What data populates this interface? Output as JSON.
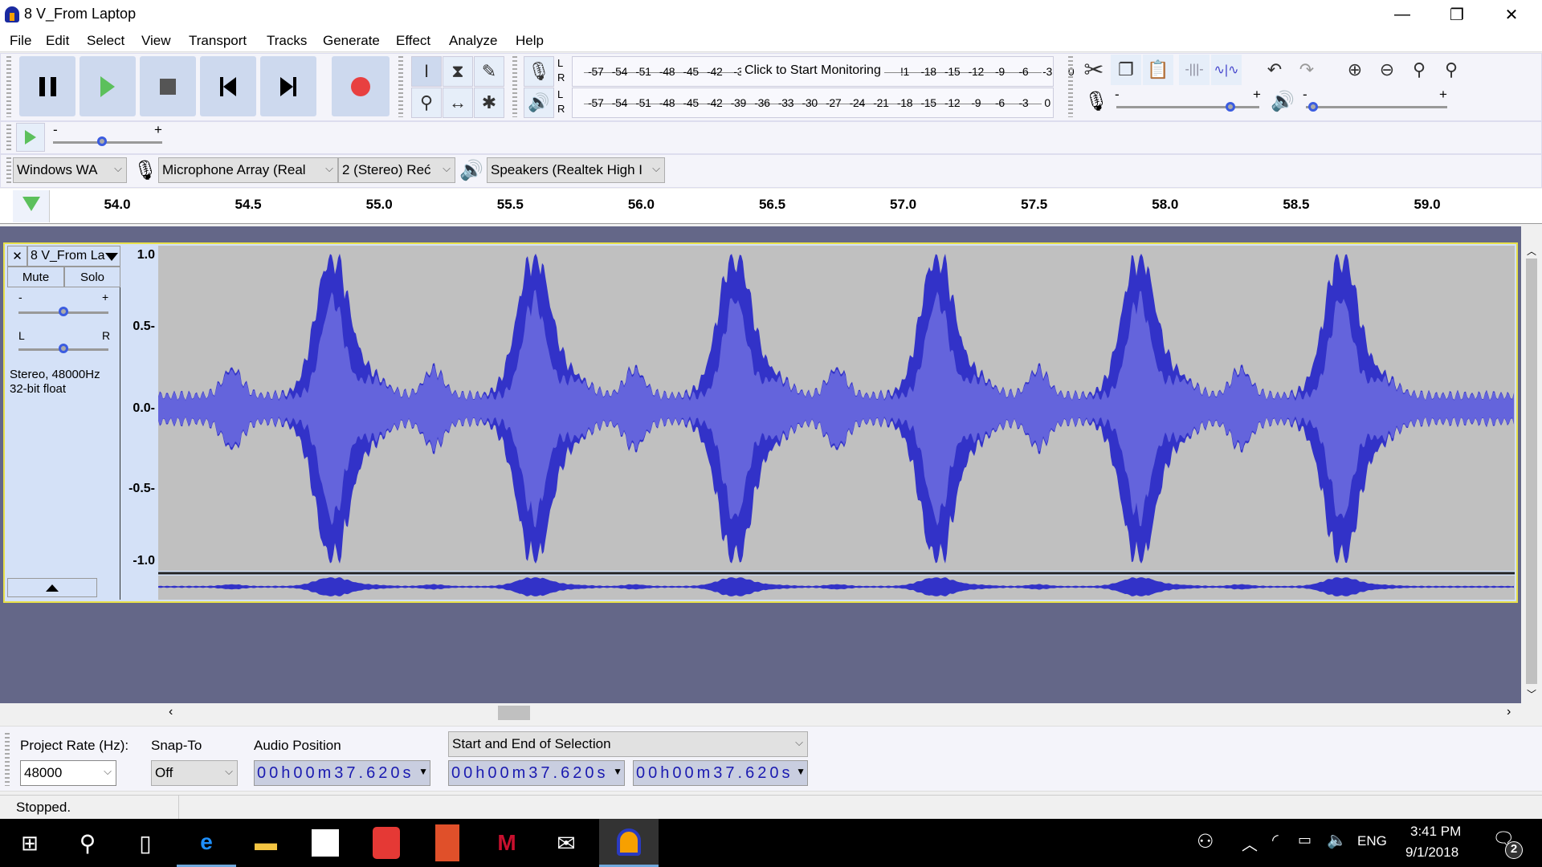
{
  "window": {
    "title": "8 V_From Laptop",
    "minimize": "—",
    "restore": "❐",
    "close": "✕"
  },
  "menu": [
    "File",
    "Edit",
    "Select",
    "View",
    "Transport",
    "Tracks",
    "Generate",
    "Effect",
    "Analyze",
    "Help"
  ],
  "meter": {
    "record_ticks": [
      "-57",
      "-54",
      "-51",
      "-48",
      "-45",
      "-42",
      "-3",
      "",
      "",
      "",
      "",
      "",
      "",
      "!1",
      "-18",
      "-15",
      "-12",
      "-9",
      "-6",
      "-3",
      "0"
    ],
    "monitor_label": "Click to Start Monitoring",
    "play_ticks": [
      "-57",
      "-54",
      "-51",
      "-48",
      "-45",
      "-42",
      "-39",
      "-36",
      "-33",
      "-30",
      "-27",
      "-24",
      "-21",
      "-18",
      "-15",
      "-12",
      "-9",
      "-6",
      "-3",
      "0"
    ],
    "L": "L",
    "R": "R"
  },
  "sliders": {
    "minus": "-",
    "plus": "+",
    "play_speed": 0.45,
    "record_volume": 0.8,
    "playback_volume": 0.05
  },
  "devices": {
    "host": "Windows WA",
    "mic": "Microphone Array (Real",
    "channels": "2 (Stereo) Reć",
    "output": "Speakers (Realtek High I"
  },
  "ruler": {
    "labels": [
      "54.0",
      "54.5",
      "55.0",
      "55.5",
      "56.0",
      "56.5",
      "57.0",
      "57.5",
      "58.0",
      "58.5",
      "59.0"
    ]
  },
  "track": {
    "name": "8 V_From La",
    "close": "✕",
    "mute": "Mute",
    "solo": "Solo",
    "gain_minus": "-",
    "gain_plus": "+",
    "pan_l": "L",
    "pan_r": "R",
    "info1": "Stereo, 48000Hz",
    "info2": "32-bit float",
    "gain": 0.5,
    "pan": 0.5,
    "scale": [
      "1.0",
      "0.5-",
      "0.0-",
      "-0.5-",
      "-1.0"
    ],
    "wave_color": "#3232c8",
    "wave_light": "#6464dc",
    "bg": "#c0c0c0"
  },
  "selection": {
    "rate_label": "Project Rate (Hz):",
    "rate": "48000",
    "snap_label": "Snap-To",
    "snap": "Off",
    "pos_label": "Audio Position",
    "sel_mode": "Start and End of Selection",
    "audio_position": "00h00m37.620s",
    "start": "00h00m37.620s",
    "end": "00h00m37.620s"
  },
  "status": "Stopped.",
  "tray": {
    "lang": "ENG",
    "time": "3:41 PM",
    "date": "9/1/2018",
    "notifications": "2"
  }
}
